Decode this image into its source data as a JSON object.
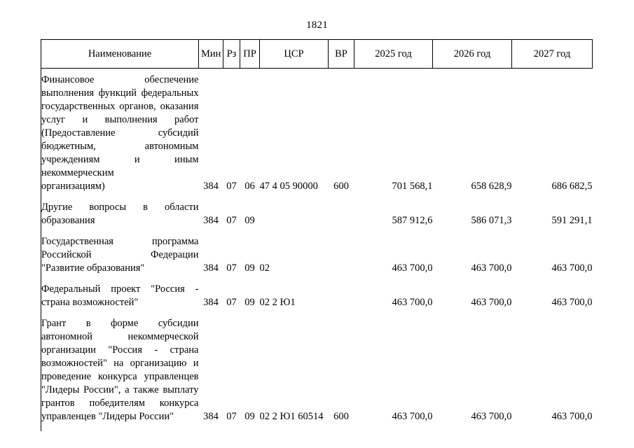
{
  "page": {
    "number": "1821"
  },
  "table": {
    "headers": [
      {
        "key": "name",
        "label": "Наименование"
      },
      {
        "key": "min",
        "label": "Мин"
      },
      {
        "key": "rz",
        "label": "Рз"
      },
      {
        "key": "pr",
        "label": "ПР"
      },
      {
        "key": "csr",
        "label": "ЦСР"
      },
      {
        "key": "vr",
        "label": "ВР"
      },
      {
        "key": "y2025",
        "label": "2025 год"
      },
      {
        "key": "y2026",
        "label": "2026 год"
      },
      {
        "key": "y2027",
        "label": "2027 год"
      }
    ],
    "rows": [
      {
        "name_lines": [
          "Финансовое обеспечение выполнения функций федеральных государственных органов, оказания услуг и выполнения работ (Предоставление субсидий бюджетным, автономным учреждениям и иным некоммерческим"
        ],
        "name_last": "организациям)",
        "min": "384",
        "rz": "07",
        "pr": "06",
        "csr": "47 4 05 90000",
        "vr": "600",
        "y2025": "701 568,1",
        "y2026": "658 628,9",
        "y2027": "686 682,5"
      },
      {
        "name_lines": [
          "Другие вопросы в области"
        ],
        "name_last": "образования",
        "min": "384",
        "rz": "07",
        "pr": "09",
        "csr": "",
        "vr": "",
        "y2025": "587 912,6",
        "y2026": "586 071,3",
        "y2027": "591 291,1"
      },
      {
        "name_lines": [
          "Государственная программа Российской Федерации"
        ],
        "name_last": "\"Развитие образования\"",
        "min": "384",
        "rz": "07",
        "pr": "09",
        "csr": "02",
        "vr": "",
        "y2025": "463 700,0",
        "y2026": "463 700,0",
        "y2027": "463 700,0"
      },
      {
        "name_lines": [
          "Федеральный проект \"Россия -"
        ],
        "name_last": "страна возможностей\"",
        "min": "384",
        "rz": "07",
        "pr": "09",
        "csr": "02 2 Ю1",
        "vr": "",
        "y2025": "463 700,0",
        "y2026": "463 700,0",
        "y2027": "463 700,0"
      },
      {
        "name_lines": [
          "Грант в форме субсидии автономной некоммерческой организации \"Россия - страна возможностей\" на организацию и проведение конкурса управленцев \"Лидеры России\", а также выплату грантов победителям конкурса"
        ],
        "name_last": "управленцев \"Лидеры России\"",
        "min": "384",
        "rz": "07",
        "pr": "09",
        "csr": "02 2 Ю1 60514",
        "vr": "600",
        "y2025": "463 700,0",
        "y2026": "463 700,0",
        "y2027": "463 700,0"
      }
    ]
  }
}
